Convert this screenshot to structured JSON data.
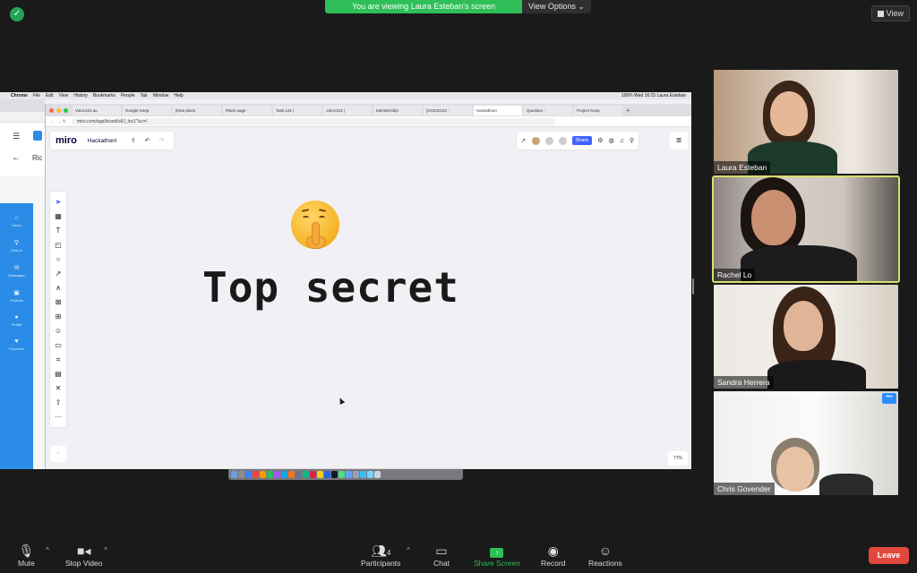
{
  "banner": {
    "message": "You are viewing Laura Esteban's screen",
    "view_options": "View Options ⌄"
  },
  "view_button": "View",
  "mac_menu": [
    "Chrome",
    "File",
    "Edit",
    "View",
    "History",
    "Bookmarks",
    "People",
    "Tab",
    "Window",
    "Help"
  ],
  "mac_status": "100%   Wed 16:15   Laura Esteban",
  "back_window": {
    "title_fragment": "Ric",
    "sidebar": [
      "Home",
      "Search",
      "Messages",
      "Projects",
      "Profile",
      "Favorites"
    ]
  },
  "browser": {
    "tabs": [
      "Voice123 au",
      "Google Keep",
      "[New plans",
      "Plans page",
      "Task List | ",
      "Voice123 | ",
      "Membership",
      "[VOICE123 -",
      "Hackathon!",
      "Question - ",
      "Project Keep"
    ],
    "active_tab": 8,
    "url": "miro.com/app/board/o9J_lce1?uc=/"
  },
  "miro": {
    "logo": "miro",
    "board_name": "Hackathon!",
    "share_label": "Share",
    "canvas_text": "Top secret",
    "zoom": "77%"
  },
  "participants": [
    {
      "name": "Laura Esteban"
    },
    {
      "name": "Rachel Lo"
    },
    {
      "name": "Sandra Herrera"
    },
    {
      "name": "Chris Govender"
    }
  ],
  "controls": {
    "mute": "Mute",
    "stop_video": "Stop Video",
    "participants": "Participants",
    "participants_count": "4",
    "chat": "Chat",
    "share_screen": "Share Screen",
    "record": "Record",
    "reactions": "Reactions",
    "leave": "Leave"
  },
  "colors": {
    "banner_green": "#2fbf58",
    "leave_red": "#e0483e",
    "speaker_outline": "#d6df6c",
    "miro_blue": "#4262ff"
  }
}
